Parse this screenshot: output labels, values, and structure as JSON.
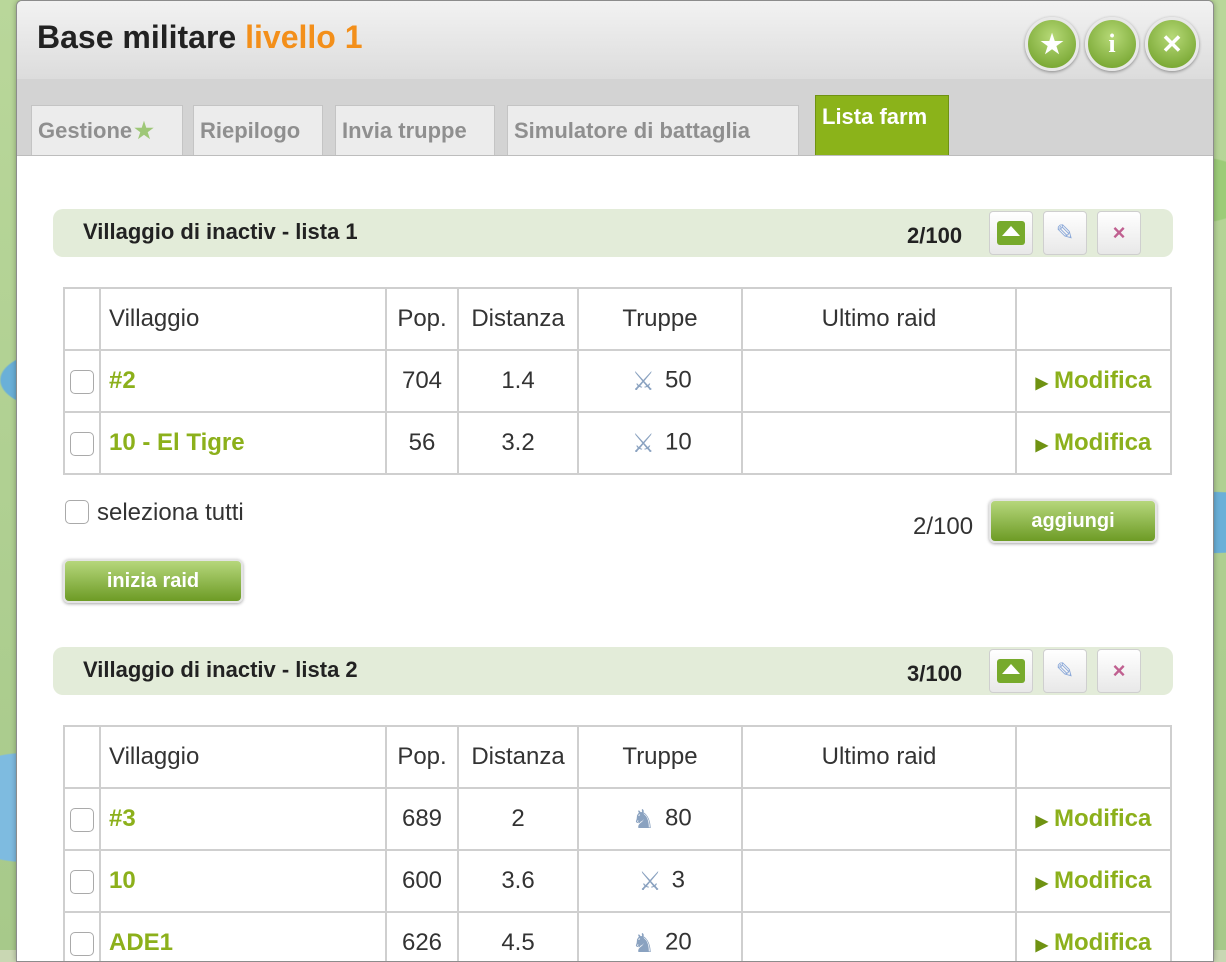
{
  "window": {
    "title": "Base militare",
    "level": "livello 1",
    "buttons": {
      "favorite": "★",
      "info": "i",
      "close": "✕"
    }
  },
  "tabs": [
    {
      "label": "Gestione",
      "active": false
    },
    {
      "label": "Riepilogo",
      "active": false
    },
    {
      "label": "Invia truppe",
      "active": false
    },
    {
      "label": "Simulatore di battaglia",
      "active": false
    },
    {
      "label": "Lista farm",
      "active": true
    }
  ],
  "columns": {
    "village": "Villaggio",
    "pop": "Pop.",
    "distance": "Distanza",
    "troops": "Truppe",
    "last_raid": "Ultimo raid"
  },
  "lists": [
    {
      "name": "Villaggio di inactiv - lista 1",
      "count": "2/100",
      "rows": [
        {
          "village": "#2",
          "pop": "704",
          "distance": "1.4",
          "troop_icon": "sword-icon",
          "troops": "50",
          "last_raid": "",
          "action": "Modifica"
        },
        {
          "village": "10 - El Tigre",
          "pop": "56",
          "distance": "3.2",
          "troop_icon": "sword-icon",
          "troops": "10",
          "last_raid": "",
          "action": "Modifica"
        }
      ],
      "select_all": "seleziona tutti",
      "footer_count": "2/100",
      "add_label": "aggiungi",
      "raid_label": "inizia raid"
    },
    {
      "name": "Villaggio di inactiv - lista 2",
      "count": "3/100",
      "rows": [
        {
          "village": "#3",
          "pop": "689",
          "distance": "2",
          "troop_icon": "horse-icon",
          "troops": "80",
          "last_raid": "",
          "action": "Modifica"
        },
        {
          "village": "10",
          "pop": "600",
          "distance": "3.6",
          "troop_icon": "sword-icon",
          "troops": "3",
          "last_raid": "",
          "action": "Modifica"
        },
        {
          "village": "ADE1",
          "pop": "626",
          "distance": "4.5",
          "troop_icon": "horse-icon",
          "troops": "20",
          "last_raid": "",
          "action": "Modifica"
        }
      ]
    }
  ],
  "colors": {
    "accent_green": "#8cb01b",
    "level_orange": "#f38f1a",
    "tab_active": "#8bb31a"
  }
}
